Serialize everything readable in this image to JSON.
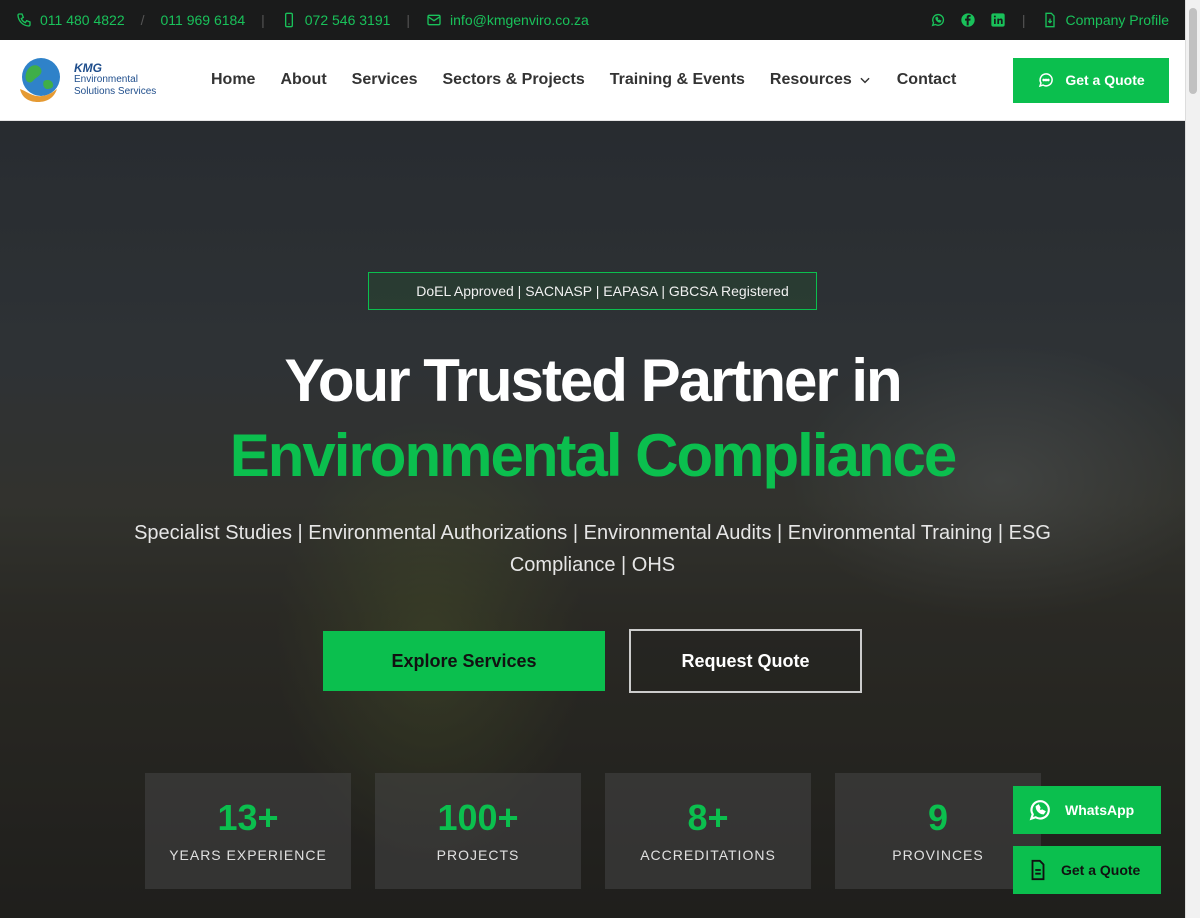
{
  "topbar": {
    "phone1": "011 480 4822",
    "phone2": "011 969 6184",
    "mobile": "072 546 3191",
    "email": "info@kmgenviro.co.za",
    "company_profile": "Company Profile",
    "slash": "/"
  },
  "logo": {
    "brand": "KMG",
    "line1": "Environmental",
    "line2": "Solutions Services"
  },
  "nav": {
    "items": [
      "Home",
      "About",
      "Services",
      "Sectors & Projects",
      "Training & Events",
      "Resources",
      "Contact"
    ]
  },
  "header": {
    "quote_label": "Get a Quote"
  },
  "hero": {
    "badge": "DoEL Approved | SACNASP | EAPASA | GBCSA Registered",
    "title_line1": "Your Trusted Partner in",
    "title_line2": "Environmental Compliance",
    "subtitle": "Specialist Studies | Environmental Authorizations | Environmental Audits | Environmental Training | ESG Compliance | OHS",
    "primary_cta": "Explore Services",
    "secondary_cta": "Request Quote"
  },
  "stats": [
    {
      "value": "13+",
      "label": "YEARS EXPERIENCE"
    },
    {
      "value": "100+",
      "label": "PROJECTS"
    },
    {
      "value": "8+",
      "label": "ACCREDITATIONS"
    },
    {
      "value": "9",
      "label": "PROVINCES"
    }
  ],
  "floating": {
    "whatsapp": "WhatsApp",
    "quote": "Get a Quote"
  },
  "colors": {
    "accent": "#0bbf4e",
    "topbar_bg": "#1a1b1b"
  }
}
